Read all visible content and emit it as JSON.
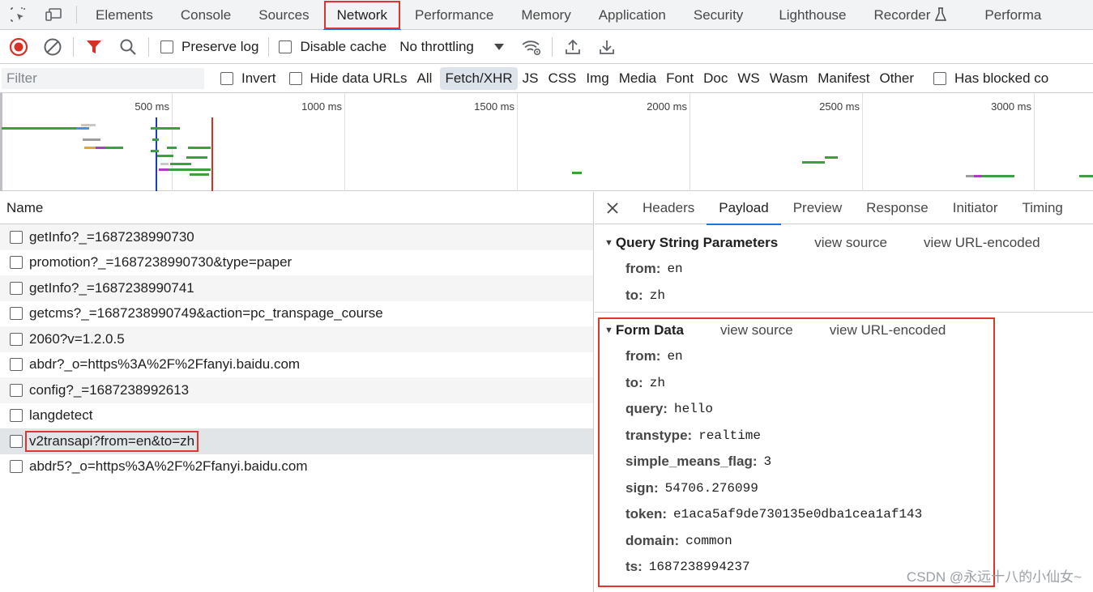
{
  "tabs": [
    "Elements",
    "Console",
    "Sources",
    "Network",
    "Performance",
    "Memory",
    "Application",
    "Security",
    "Lighthouse",
    "Recorder",
    "Performa"
  ],
  "active_tab": "Network",
  "toolbar": {
    "preserve_log": "Preserve log",
    "disable_cache": "Disable cache",
    "throttling": "No throttling"
  },
  "filterbar": {
    "placeholder": "Filter",
    "invert": "Invert",
    "hide_data_urls": "Hide data URLs",
    "types": [
      "All",
      "Fetch/XHR",
      "JS",
      "CSS",
      "Img",
      "Media",
      "Font",
      "Doc",
      "WS",
      "Wasm",
      "Manifest",
      "Other"
    ],
    "selected_type": "Fetch/XHR",
    "has_blocked": "Has blocked co"
  },
  "overview": {
    "ticks": [
      "500 ms",
      "1000 ms",
      "1500 ms",
      "2000 ms",
      "2500 ms",
      "3000 ms"
    ]
  },
  "requests": {
    "header": "Name",
    "items": [
      "getInfo?_=1687238990730",
      "promotion?_=1687238990730&type=paper",
      "getInfo?_=1687238990741",
      "getcms?_=1687238990749&action=pc_transpage_course",
      "2060?v=1.2.0.5",
      "abdr?_o=https%3A%2F%2Ffanyi.baidu.com",
      "config?_=1687238992613",
      "langdetect",
      "v2transapi?from=en&to=zh",
      "abdr5?_o=https%3A%2F%2Ffanyi.baidu.com"
    ],
    "selected": "v2transapi?from=en&to=zh"
  },
  "detail": {
    "tabs": [
      "Headers",
      "Payload",
      "Preview",
      "Response",
      "Initiator",
      "Timing"
    ],
    "active_tab": "Payload",
    "query": {
      "title": "Query String Parameters",
      "view_source": "view source",
      "view_url_encoded": "view URL-encoded",
      "params": [
        {
          "key": "from:",
          "value": "en"
        },
        {
          "key": "to:",
          "value": "zh"
        }
      ]
    },
    "form": {
      "title": "Form Data",
      "view_source": "view source",
      "view_url_encoded": "view URL-encoded",
      "params": [
        {
          "key": "from:",
          "value": "en"
        },
        {
          "key": "to:",
          "value": "zh"
        },
        {
          "key": "query:",
          "value": "hello"
        },
        {
          "key": "transtype:",
          "value": "realtime"
        },
        {
          "key": "simple_means_flag:",
          "value": "3"
        },
        {
          "key": "sign:",
          "value": "54706.276099"
        },
        {
          "key": "token:",
          "value": "e1aca5af9de730135e0dba1cea1af143"
        },
        {
          "key": "domain:",
          "value": "common"
        },
        {
          "key": "ts:",
          "value": "1687238994237"
        }
      ]
    }
  },
  "watermark": "CSDN @永远十八的小仙女~",
  "colors": {
    "accent": "#1a73e8",
    "highlight": "#e0342f",
    "record": "#d93025"
  }
}
